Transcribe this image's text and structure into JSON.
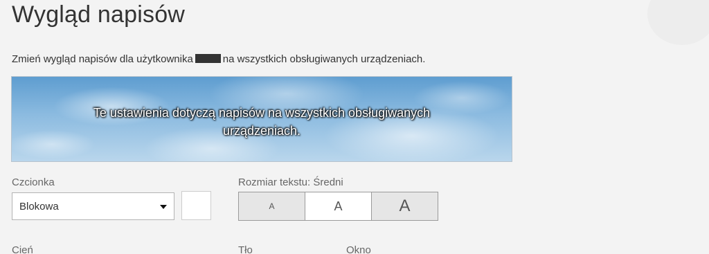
{
  "header": {
    "title": "Wygląd napisów"
  },
  "description": {
    "before": "Zmień wygląd napisów dla użytkownika",
    "after": "na wszystkich obsługiwanych urządzeniach."
  },
  "preview": {
    "line1": "Te ustawienia dotyczą napisów na wszystkich obsługiwanych",
    "line2": "urządzeniach."
  },
  "font": {
    "label": "Czcionka",
    "selected": "Blokowa",
    "color": "#ffffff"
  },
  "text_size": {
    "label": "Rozmiar tekstu: Średni",
    "options": [
      "A",
      "A",
      "A"
    ],
    "selected_index": 1
  },
  "shadow": {
    "label": "Cień"
  },
  "background": {
    "label": "Tło"
  },
  "window": {
    "label": "Okno"
  },
  "icons": {
    "dropdown": "caret-down-icon"
  }
}
